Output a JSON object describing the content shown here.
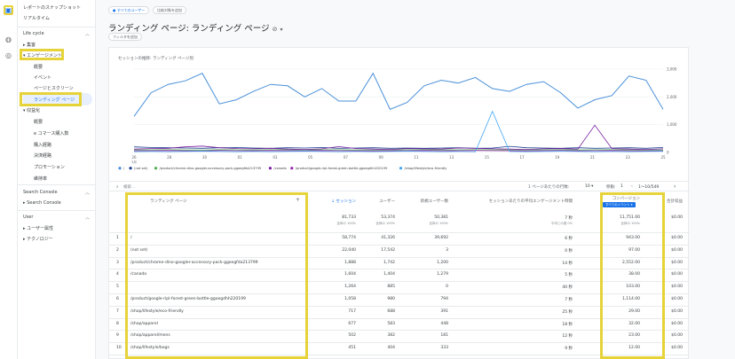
{
  "rail": {
    "icons": [
      "reports-icon",
      "explore-icon",
      "advertising-icon"
    ]
  },
  "sidebar": {
    "snapshot": "レポートのスナップショット",
    "realtime": "リアルタイム",
    "lifecycle": "Life cycle",
    "acquisition": "集客",
    "engagement": "エンゲージメント",
    "eng_items": [
      "概要",
      "イベント",
      "ページとスクリーン",
      "ランディング ページ"
    ],
    "monetization": "収益化",
    "mon_items": [
      "概要",
      "e コマース購入数",
      "購入経路",
      "決済経路",
      "プロモーション"
    ],
    "retention": "維持率",
    "search_console_header": "Search Console",
    "search_console": "Search Console",
    "user_header": "User",
    "user_attr": "ユーザー属性",
    "tech": "テクノロジー"
  },
  "header": {
    "chip_all_users": "すべてのユーザー",
    "chip_compare": "比較対象を追加",
    "title": "ランディング ページ: ランディング ページ",
    "filter_chip": "フィルタを追加"
  },
  "chart_data": {
    "type": "line",
    "title": "セッションの推移: ランディング ページ別",
    "x": [
      "26",
      "28",
      "30",
      "01",
      "03",
      "05",
      "07",
      "09",
      "11",
      "13",
      "15",
      "17",
      "19",
      "21",
      "23",
      "25"
    ],
    "x_sub": "3月",
    "y_ticks": [
      "3,000",
      "2,000",
      "1,000",
      "0"
    ],
    "ylim": [
      0,
      3000
    ],
    "series": [
      {
        "name": "/",
        "color": "#4a90d9",
        "values": [
          1300,
          2150,
          2450,
          2580,
          2850,
          1750,
          1900,
          2200,
          2450,
          2400,
          2000,
          2300,
          1850,
          1850,
          2850,
          1550,
          1800,
          2400,
          2600,
          2500,
          2700,
          2300,
          2200,
          2450,
          2550,
          2150,
          1600,
          1900,
          2050,
          2750,
          2600,
          1550
        ]
      },
      {
        "name": "(not set)",
        "color": "#1b3d8f",
        "values": [
          200,
          180,
          170,
          160,
          150,
          170,
          180,
          160,
          150,
          170,
          160,
          180,
          150,
          160,
          170,
          150,
          160,
          150,
          160,
          170,
          150,
          160,
          220,
          170,
          160,
          150,
          170,
          150,
          160,
          170,
          150,
          180
        ]
      },
      {
        "name": "/product/chrome-dino-googler-accessory-pack-ggoegfda213799",
        "color": "#4caf50",
        "values": [
          90,
          95,
          100,
          90,
          85,
          100,
          95,
          90,
          100,
          95,
          90,
          100,
          95,
          90,
          85,
          90,
          95,
          100,
          90,
          95,
          100,
          95,
          90,
          85,
          95,
          100,
          90,
          95,
          100,
          90,
          85,
          90
        ]
      },
      {
        "name": "/canada",
        "color": "#7b1fa2",
        "values": [
          120,
          140,
          150,
          200,
          230,
          170,
          140,
          130,
          150,
          120,
          110,
          130,
          210,
          140,
          120,
          110,
          140,
          130,
          120,
          160,
          150,
          130,
          120,
          110,
          130,
          140,
          120,
          980,
          140,
          120,
          110,
          130
        ]
      },
      {
        "name": "/product/google-ripl-forest-green-bottle-ggoegdhh220199",
        "color": "#9c27b0",
        "values": [
          60,
          65,
          70,
          60,
          55,
          70,
          65,
          60,
          70,
          65,
          60,
          70,
          65,
          60,
          55,
          60,
          65,
          70,
          60,
          65,
          70,
          65,
          60,
          55,
          65,
          70,
          60,
          65,
          70,
          60,
          55,
          60
        ]
      },
      {
        "name": "/shop/lifestyle/eco-friendly",
        "color": "#42a5f5",
        "values": [
          30,
          35,
          30,
          35,
          40,
          35,
          30,
          35,
          30,
          35,
          40,
          35,
          30,
          35,
          30,
          35,
          40,
          35,
          30,
          35,
          30,
          1480,
          35,
          30,
          35,
          40,
          35,
          30,
          35,
          30,
          35,
          40
        ]
      }
    ]
  },
  "table": {
    "search": "検索...",
    "rows_per_page_label": "1 ページあたりの行数:",
    "rows_per_page": "10",
    "goto_label": "移動:",
    "goto_value": "1",
    "pagination": "1〜10/549",
    "headers": {
      "landing": "ランディング ページ",
      "sessions": "セッション",
      "users": "ユーザー",
      "new_users": "新規ユーザー数",
      "avg_eng": "セッションあたりの平均エンゲージメント時間",
      "conversions": "コンバージョン",
      "conv_sub": "すべてのイベント",
      "revenue": "合計収益"
    },
    "totals": {
      "sessions": "81,733",
      "sessions_sub": "全体の 100%",
      "users": "53,374",
      "users_sub": "全体の 100%",
      "new_users": "50,381",
      "new_users_sub": "全体の 100%",
      "avg_eng": "7 秒",
      "avg_eng_sub": "平均との差 0%",
      "conversions": "11,751.00",
      "conversions_sub": "全体の 100%",
      "revenue": "$0.00"
    },
    "rows": [
      {
        "n": "1",
        "page": "/",
        "sessions": "58,774",
        "users": "41,326",
        "new_users": "39,692",
        "eng": "6 秒",
        "conv": "943.00",
        "rev": "$0.00"
      },
      {
        "n": "2",
        "page": "(not set)",
        "sessions": "22,040",
        "users": "17,542",
        "new_users": "3",
        "eng": "0 秒",
        "conv": "97.00",
        "rev": "$0.00"
      },
      {
        "n": "3",
        "page": "/product/chrome-dino-googler-accessory-pack-ggoegfda213799",
        "sessions": "1,888",
        "users": "1,742",
        "new_users": "1,200",
        "eng": "14 秒",
        "conv": "2,552.00",
        "rev": "$0.00"
      },
      {
        "n": "4",
        "page": "/canada",
        "sessions": "1,604",
        "users": "1,404",
        "new_users": "1,279",
        "eng": "5 秒",
        "conv": "38.00",
        "rev": "$0.00"
      },
      {
        "n": "5",
        "page": "",
        "sessions": "1,264",
        "users": "885",
        "new_users": "0",
        "eng": "40 秒",
        "conv": "103.00",
        "rev": "$0.00"
      },
      {
        "n": "6",
        "page": "/product/google-ripl-forest-green-bottle-ggoegdhh220199",
        "sessions": "1,058",
        "users": "980",
        "new_users": "794",
        "eng": "7 秒",
        "conv": "1,114.00",
        "rev": "$0.00"
      },
      {
        "n": "7",
        "page": "/shop/lifestyle/eco-friendly",
        "sessions": "717",
        "users": "688",
        "new_users": "391",
        "eng": "25 秒",
        "conv": "29.00",
        "rev": "$0.00"
      },
      {
        "n": "8",
        "page": "/shop/apparel",
        "sessions": "677",
        "users": "583",
        "new_users": "448",
        "eng": "18 秒",
        "conv": "32.00",
        "rev": "$0.00"
      },
      {
        "n": "9",
        "page": "/shop/apparel/mens",
        "sessions": "502",
        "users": "382",
        "new_users": "181",
        "eng": "12 秒",
        "conv": "23.00",
        "rev": "$0.00"
      },
      {
        "n": "10",
        "page": "/shop/lifestyle/bags",
        "sessions": "451",
        "users": "404",
        "new_users": "333",
        "eng": "9 秒",
        "conv": "12.00",
        "rev": "$0.00"
      }
    ]
  }
}
